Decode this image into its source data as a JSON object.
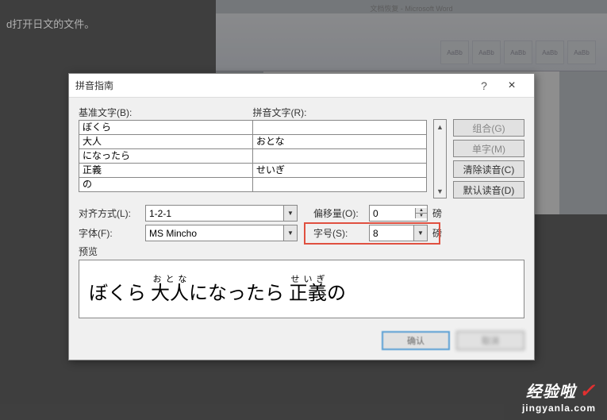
{
  "bg_text": "d打开日文的文件。",
  "word": {
    "title": "文档恢复 - Microsoft Word",
    "styles": [
      "AaBb",
      "AaBb",
      "AaBb",
      "AaBb",
      "AaBb"
    ]
  },
  "dialog": {
    "title": "拼音指南",
    "labels": {
      "base": "基准文字(B):",
      "ruby": "拼音文字(R):",
      "align": "对齐方式(L):",
      "offset": "偏移量(O):",
      "font": "字体(F):",
      "size": "字号(S):",
      "preview": "预览"
    },
    "rows": [
      {
        "base": "ぼくら",
        "ruby": ""
      },
      {
        "base": "大人",
        "ruby": "おとな"
      },
      {
        "base": "になったら",
        "ruby": ""
      },
      {
        "base": "正義",
        "ruby": "せいぎ"
      },
      {
        "base": "の",
        "ruby": ""
      }
    ],
    "buttons": {
      "group": "组合(G)",
      "mono": "单字(M)",
      "clear": "清除读音(C)",
      "default": "默认读音(D)",
      "ok": "确认",
      "cancel": "取消"
    },
    "align_value": "1-2-1",
    "offset_value": "0",
    "offset_unit": "磅",
    "font_value": "MS Mincho",
    "size_value": "8",
    "size_unit": "磅",
    "preview_text": {
      "seg1": "ぼくら ",
      "seg2_base": "大人",
      "seg2_ruby": "おとな",
      "seg3": "になったら ",
      "seg4_base": "正義",
      "seg4_ruby": "せいぎ",
      "seg5": "の"
    }
  },
  "watermark": {
    "line1": "经验啦",
    "line2": "jingyanla.com"
  }
}
